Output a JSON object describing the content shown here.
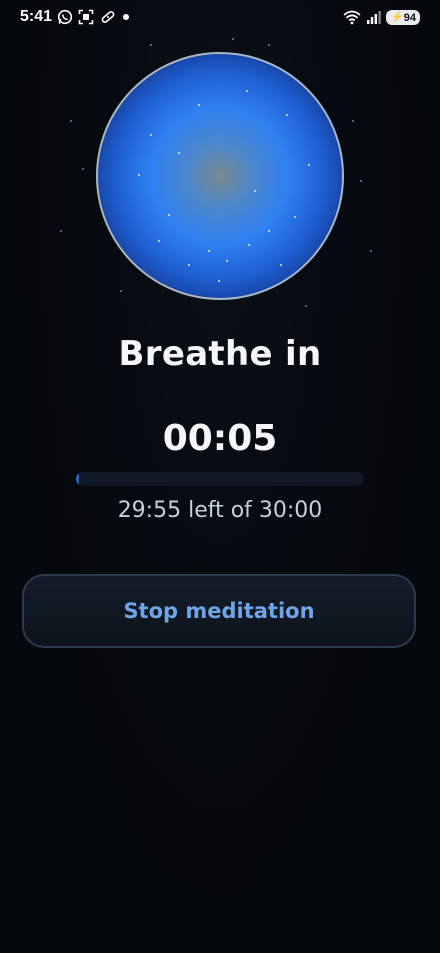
{
  "status_bar": {
    "time": "5:41",
    "battery": "94",
    "icons": [
      "whatsapp-icon",
      "screenshot-icon",
      "bandage-icon",
      "notification-dot",
      "wifi-icon",
      "signal-icon",
      "battery-icon"
    ]
  },
  "session": {
    "phase": "Breathe in",
    "timer": "00:05",
    "remaining": "29:55 left of 30:00",
    "progress": 0.003
  },
  "actions": {
    "stop_label": "Stop meditation"
  },
  "colors": {
    "accent": "#6ea5e8",
    "orb_core": "#2f80f2",
    "background": "#05080d"
  }
}
